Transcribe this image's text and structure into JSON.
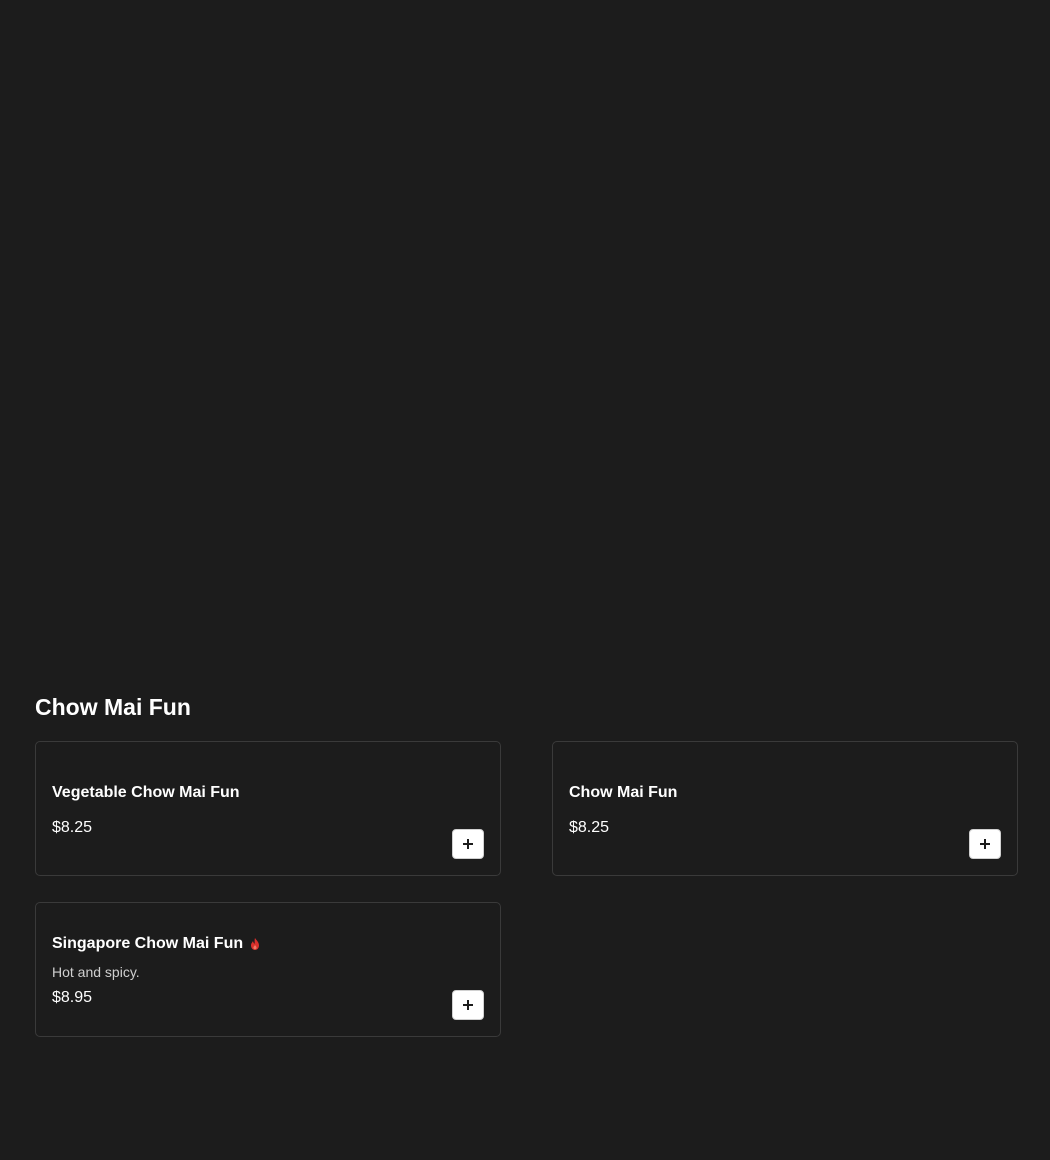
{
  "section": {
    "title": "Chow Mai Fun"
  },
  "items": [
    {
      "name": "Vegetable Chow Mai Fun",
      "description": "",
      "price": "$8.25"
    },
    {
      "name": "Chow Mai Fun",
      "description": "",
      "price": "$8.25"
    },
    {
      "name": "Singapore Chow Mai Fun",
      "description": "Hot and spicy.",
      "price": "$8.95",
      "icon": "spicy-fire-icon"
    }
  ],
  "colors": {
    "background": "#1c1c1c",
    "card_border": "#3a3a3a",
    "spicy": "#d9302c"
  }
}
